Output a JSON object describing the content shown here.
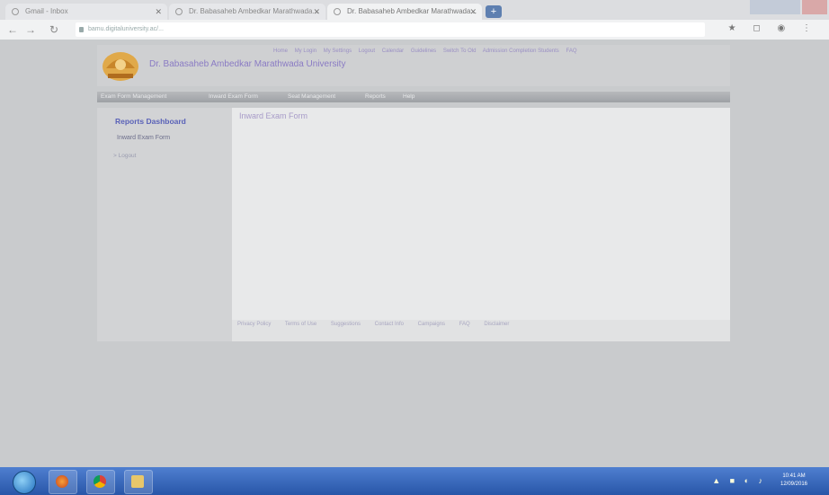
{
  "browser": {
    "tabs": [
      {
        "label": "Gmail - Inbox"
      },
      {
        "label": "Dr. Babasaheb Ambedkar Marathwada..."
      },
      {
        "label": "Dr. Babasaheb Ambedkar Marathwada..."
      }
    ],
    "new_tab_label": "+",
    "url": "bamu.digitaluniversity.ac/..."
  },
  "site": {
    "university_name": "Dr. Babasaheb Ambedkar Marathwada University",
    "top_links": [
      "Home",
      "My Login",
      "My Settings",
      "Logout",
      "Calendar",
      "Guidelines",
      "Switch To Old",
      "Admission Completion Students",
      "FAQ"
    ],
    "menu": [
      "Exam Form Management",
      "Inward Exam Form",
      "Seat Management",
      "Reports",
      "Help"
    ]
  },
  "sidebar": {
    "title": "Reports Dashboard",
    "item": "Inward Exam Form",
    "logout": "> Logout"
  },
  "content": {
    "title": "Inward Exam Form"
  },
  "footer": {
    "links": [
      "Privacy Policy",
      "Terms of Use",
      "Suggestions",
      "Contact Info",
      "Campaigns",
      "FAQ",
      "Disclaimer"
    ]
  },
  "taskbar": {
    "time": "10:41 AM",
    "date": "12/09/2016"
  },
  "colors": {
    "accent": "#5a62b8",
    "taskbar": "#2856a8"
  }
}
